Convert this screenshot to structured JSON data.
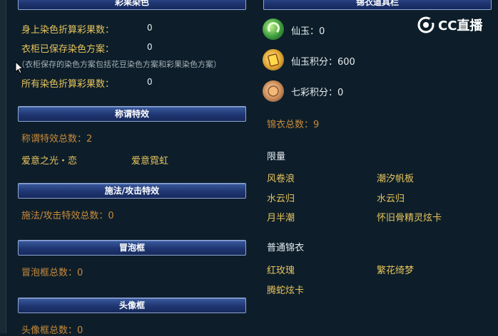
{
  "dye": {
    "header": "彩果染色",
    "row1_label": "身上染色折算彩果数：",
    "row1_value": "0",
    "row2_label": "衣柜已保存染色方案：",
    "row2_value": "0",
    "note": "（衣柜保存的染色方案包括花豆染色方案和彩果染色方案）",
    "row3_label": "所有染色折算彩果数：",
    "row3_value": "0"
  },
  "title_effect": {
    "header": "称谓特效",
    "total": "称谓特效总数：2",
    "items": [
      "爱意之光・恋",
      "爱意霓虹"
    ]
  },
  "spell": {
    "header": "施法/攻击特效",
    "total": "施法/攻击特效总数：0"
  },
  "bubble": {
    "header": "冒泡框",
    "total": "冒泡框总数：0"
  },
  "avatar_frame": {
    "header": "头像框",
    "total": "头像框总数：0"
  },
  "wardrobe": {
    "header": "锦衣道具栏",
    "xianyu": "仙玉：0",
    "xianyu_points": "仙玉积分：600",
    "qicai_points": "七彩积分：0",
    "count": "锦衣总数：9",
    "limited_title": "限量",
    "limited_items": [
      "风卷浪",
      "潮汐帆板",
      "水云归",
      "水云归",
      "月半潮",
      "怀旧骨精灵炫卡"
    ],
    "normal_title": "普通锦衣",
    "normal_items": [
      "红玫瑰",
      "繁花绮梦",
      "腾蛇炫卡"
    ]
  },
  "logo": {
    "text": "CC直播"
  },
  "colors": {
    "yellow": "#e8c45c",
    "orange": "#c98a3a",
    "header_blue": "#1f3672"
  },
  "icons": {
    "xianyu": "green-jade-icon",
    "xianyu_points": "gold-card-icon",
    "qicai_points": "rainbow-orb-icon"
  }
}
